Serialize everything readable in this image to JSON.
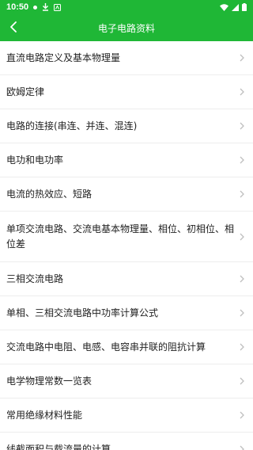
{
  "status_bar": {
    "time": "10:50"
  },
  "header": {
    "title": "电子电路资料"
  },
  "colors": {
    "accent": "#1fb736",
    "chevron": "#bfbfbf"
  },
  "items": [
    {
      "label": "直流电路定义及基本物理量"
    },
    {
      "label": "欧姆定律"
    },
    {
      "label": "电路的连接(串连、并连、混连)"
    },
    {
      "label": "电功和电功率"
    },
    {
      "label": "电流的热效应、短路"
    },
    {
      "label": "单项交流电路、交流电基本物理量、相位、初相位、相位差"
    },
    {
      "label": "三相交流电路"
    },
    {
      "label": "单相、三相交流电路中功率计算公式"
    },
    {
      "label": "交流电路中电阻、电感、电容串并联的阻抗计算"
    },
    {
      "label": "电学物理常数一览表"
    },
    {
      "label": "常用绝缘材料性能"
    },
    {
      "label": "线截面积与载流量的计算"
    }
  ]
}
